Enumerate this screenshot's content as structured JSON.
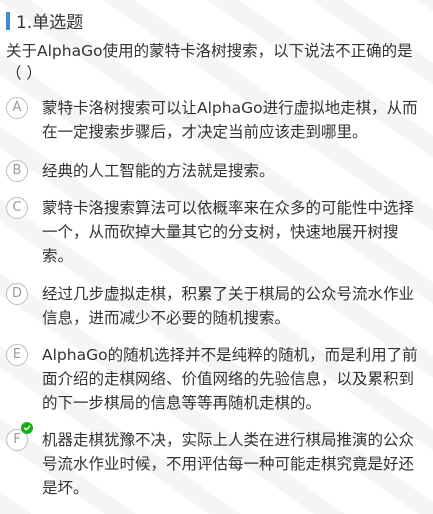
{
  "header": {
    "title": "1.单选题",
    "accent_color": "#3d8ad6"
  },
  "question": {
    "text": "关于AlphaGo使用的蒙特卡洛树搜索，以下说法不正确的是（ ）"
  },
  "options": [
    {
      "letter": "A",
      "text": "蒙特卡洛树搜索可以让AlphaGo进行虚拟地走棋，从而在一定搜索步骤后，才决定当前应该走到哪里。"
    },
    {
      "letter": "B",
      "text": "经典的人工智能的方法就是搜索。"
    },
    {
      "letter": "C",
      "text": "蒙特卡洛搜索算法可以依概率来在众多的可能性中选择一个，从而砍掉大量其它的分支树，快速地展开树搜索。"
    },
    {
      "letter": "D",
      "text": "经过几步虚拟走棋，积累了关于棋局的公众号流水作业信息，进而减少不必要的随机搜索。"
    },
    {
      "letter": "E",
      "text": "AlphaGo的随机选择并不是纯粹的随机，而是利用了前面介绍的走棋网络、价值网络的先验信息，以及累积到的下一步棋局的信息等等再随机走棋的。"
    },
    {
      "letter": "F",
      "text": "机器走棋犹豫不决，实际上人类在进行棋局推演的公众号流水作业时候，不用评估每一种可能走棋究竟是好还是坏。",
      "selected": true,
      "check_icon": "check-circle-icon",
      "check_color": "#1aad19"
    }
  ]
}
